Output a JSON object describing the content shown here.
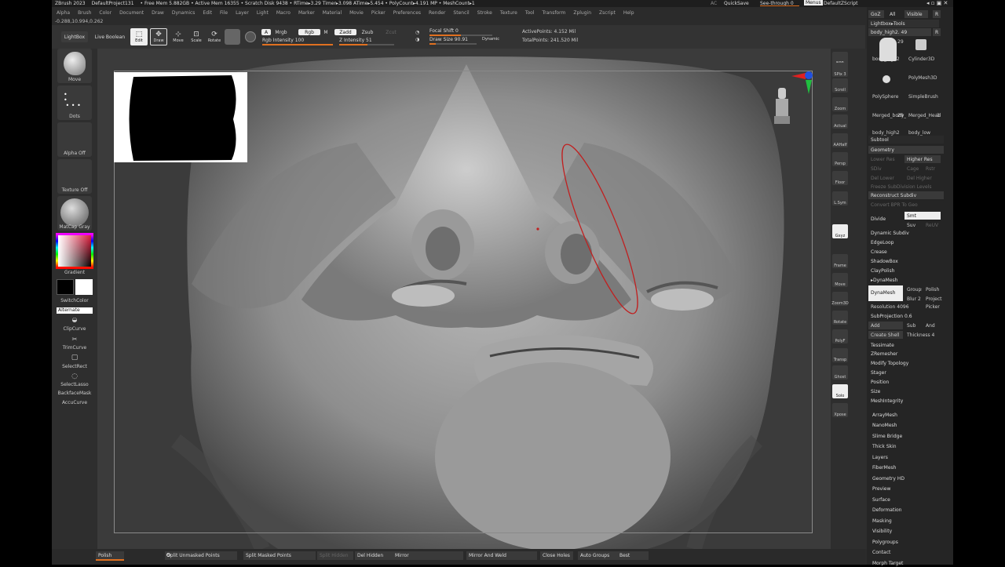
{
  "titlebar": {
    "app": "ZBrush 2023",
    "project": "DefaultProject131",
    "stats": "• Free Mem 5.882GB • Active Mem 16355 • Scratch Disk 9438 • RTime▸3.29 Timer▸3.098 ATime▸5.454 • PolyCount▸4.191 MP • MeshCount▸1",
    "ac": "AC",
    "quicksave": "QuickSave",
    "seethrough": "See-through  0",
    "menus": "Menus",
    "script": "DefaultZScript"
  },
  "menu": [
    "Alpha",
    "Brush",
    "Color",
    "Document",
    "Draw",
    "Dynamics",
    "Edit",
    "File",
    "Layer",
    "Light",
    "Macro",
    "Marker",
    "Material",
    "Movie",
    "Picker",
    "Preferences",
    "Render",
    "Stencil",
    "Stroke",
    "Texture",
    "Tool",
    "Transform",
    "Zplugin",
    "Zscript",
    "Help"
  ],
  "coords": "-0.288,10.994,0.262",
  "toolbar": {
    "lightbox": "LightBox",
    "liveboolean": "Live Boolean",
    "edit": "Edit",
    "draw": "Draw",
    "move": "Move",
    "scale": "Scale",
    "rotate": "Rotate",
    "a": "A",
    "mrgb": "Mrgb",
    "rgb": "Rgb",
    "m": "M",
    "zadd": "Zadd",
    "zsub": "Zsub",
    "zcut": "Zcut",
    "rgbint": "Rgb Intensity 100",
    "zint": "Z Intensity 51",
    "focal": "Focal Shift 0",
    "drawsize": "Draw Size 90.91",
    "dynamic": "Dynamic",
    "activepts": "ActivePoints: 4.152 Mil",
    "totalpts": "TotalPoints: 241.520 Mil"
  },
  "left": {
    "move": "Move",
    "dots": "Dots",
    "alphaoff": "Alpha Off",
    "textureoff": "Texture Off",
    "matcap": "MatCap Gray",
    "gradient": "Gradient",
    "switchcolor": "SwitchColor",
    "alternate": "Alternate",
    "clipcurve": "ClipCurve",
    "trimcurve": "TrimCurve",
    "selectrect": "SelectRect",
    "selectlasso": "SelectLasso",
    "backface": "BackfaceMask",
    "accucurve": "AccuCurve"
  },
  "right": {
    "bpr": "BPR",
    "spix": "SPix 3",
    "scroll": "Scroll",
    "zoom": "Zoom",
    "actual": "Actual",
    "aahalf": "AAHalf",
    "persp": "Persp",
    "floor": "Floor",
    "lsym": "L.Sym",
    "gxyz": "Gxyz",
    "frame": "Frame",
    "move": "Move",
    "zoom3d": "Zoom3D",
    "rotate": "Rotate",
    "polyf": "PolyF",
    "transp": "Transp",
    "ghost": "Ghost",
    "solo": "Solo",
    "xpose": "Xpose"
  },
  "panel": {
    "goz": "GoZ",
    "all": "All",
    "visible": "Visible",
    "r": "R",
    "lightboxtools": "Lightbox▸Tools",
    "bodyhigh": "body_high2. 49",
    "r2": "R",
    "t1": "body_high2",
    "t1n": "29",
    "t2": "Cylinder3D",
    "t3": "PolyMesh3D",
    "t4": "PolySphere",
    "t5": "SimpleBrush",
    "t6": "Merged_body_l",
    "t7": "Merged_Head",
    "t8": "body_high2",
    "t8n": "29",
    "t9": "body_low",
    "t9n": "3",
    "subtool": "Subtool",
    "geometry": "Geometry",
    "lowerres": "Lower Res",
    "higherres": "Higher Res",
    "sdiv": "SDiv",
    "cage": "Cage",
    "rstr": "Rstr",
    "dellower": "Del Lower",
    "delhigher": "Del Higher",
    "freeze": "Freeze SubDivision Levels",
    "reconstruct": "Reconstruct Subdiv",
    "convert": "Convert BPR To Geo",
    "divide": "Divide",
    "smt": "Smt",
    "suv": "Suv",
    "reuv": "ReUV",
    "dynsub": "Dynamic Subdiv",
    "edgeloop": "EdgeLoop",
    "crease": "Crease",
    "shadowbox": "ShadowBox",
    "claypolish": "ClayPolish",
    "dynamesh": "▸DynaMesh",
    "dynameshbtn": "DynaMesh",
    "groups": "Groups",
    "polish": "Polish",
    "blur": "Blur 2",
    "project": "Project",
    "resolution": "Resolution 4096",
    "picker": "Picker",
    "subproj": "SubProjection 0.6",
    "add": "Add",
    "sub": "Sub",
    "and": "And",
    "createshell": "Create Shell",
    "thickness": "Thickness 4",
    "tessimate": "Tessimate",
    "zremesher": "ZRemesher",
    "modtopo": "Modify Topology",
    "stager": "Stager",
    "position": "Position",
    "size": "Size",
    "meshint": "MeshIntegrity",
    "arraymesh": "ArrayMesh",
    "nanomesh": "NanoMesh",
    "slime": "Slime Bridge",
    "thickskin": "Thick Skin",
    "layers": "Layers",
    "fibermesh": "FiberMesh",
    "geohd": "Geometry HD",
    "preview": "Preview",
    "surface": "Surface",
    "deformation": "Deformation",
    "masking": "Masking",
    "visibility": "Visibility",
    "polygroups": "Polygroups",
    "contact": "Contact",
    "morph": "Morph Target"
  },
  "bottom": {
    "polish": "Polish",
    "splitunmasked": "Split Unmasked Points",
    "splitmasked": "Split Masked Points",
    "splithidden": "Split Hidden",
    "delhidden": "Del Hidden",
    "mirror": "Mirror",
    "mirrorweld": "Mirror And Weld",
    "closeholes": "Close Holes",
    "autogroups": "Auto Groups",
    "best": "Best"
  }
}
